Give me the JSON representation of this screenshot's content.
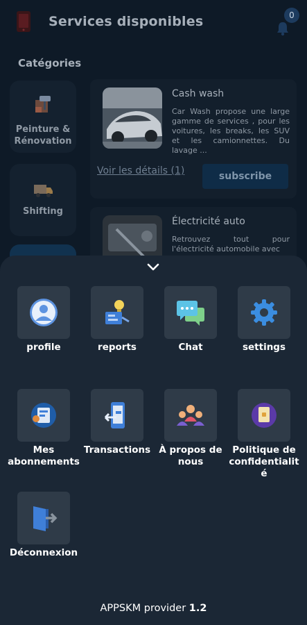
{
  "header": {
    "title": "Services disponibles",
    "notification_count": "0"
  },
  "categories": {
    "label": "Catégories",
    "items": [
      {
        "label": "Peinture & Rénovation",
        "icon": "paint-roller-icon"
      },
      {
        "label": "Shifting",
        "icon": "truck-icon"
      }
    ]
  },
  "services": [
    {
      "name": "Cash wash",
      "description": "Car Wash propose une large gamme de services , pour les voitures, les breaks, les SUV et les camionnettes. Du lavage ...",
      "details_label": "Voir les détails (1)",
      "subscribe_label": "subscribe"
    },
    {
      "name": "Électricité auto",
      "description": "Retrouvez tout pour l'électricité automobile avec"
    }
  ],
  "menu": {
    "items": [
      {
        "label": "profile",
        "icon": "user-avatar-icon"
      },
      {
        "label": "reports",
        "icon": "report-bulb-icon"
      },
      {
        "label": "Chat",
        "icon": "chat-bubbles-icon"
      },
      {
        "label": "settings",
        "icon": "gear-icon"
      },
      {
        "label": "Mes abonnements",
        "icon": "subscription-card-icon"
      },
      {
        "label": "Transactions",
        "icon": "phone-transfer-icon"
      },
      {
        "label": "À propos de nous",
        "icon": "team-people-icon"
      },
      {
        "label": "Politique de confidentialit é",
        "icon": "privacy-document-icon"
      },
      {
        "label": "Déconnexion",
        "icon": "logout-door-icon"
      }
    ]
  },
  "footer": {
    "app_name": "APPSKM provider",
    "version": "1.2"
  }
}
